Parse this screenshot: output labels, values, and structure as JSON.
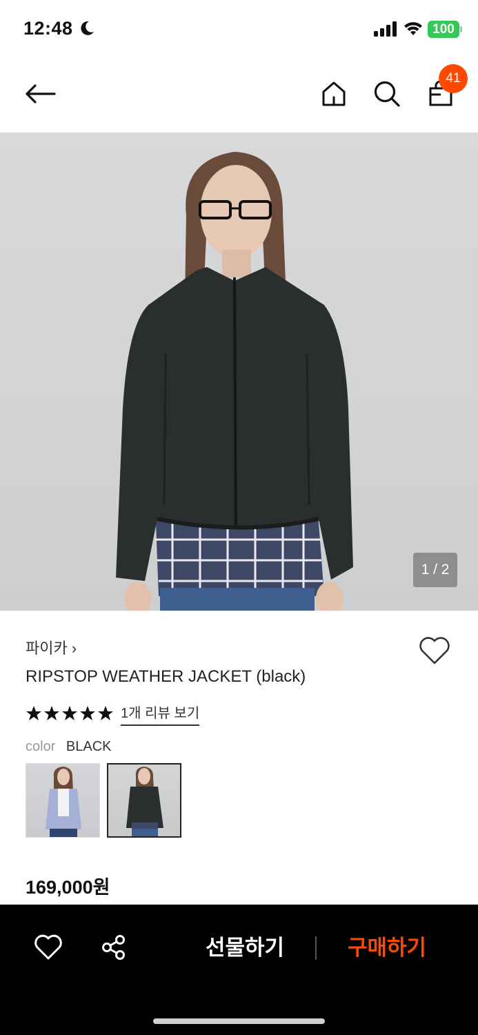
{
  "status_bar": {
    "time": "12:48",
    "battery": "100"
  },
  "nav": {
    "cart_count": "41"
  },
  "product": {
    "image_counter": "1 / 2",
    "brand": "파이카 ›",
    "name": "RIPSTOP WEATHER JACKET (black)",
    "rating_stars": 5,
    "review_link": "1개 리뷰 보기",
    "color_label": "color",
    "color_value": "BLACK",
    "price": "169,000원"
  },
  "bottom_bar": {
    "gift_label": "선물하기",
    "buy_label": "구매하기"
  },
  "colors": {
    "accent": "#ff4800",
    "battery": "#34c759",
    "bar_bg": "#000000"
  },
  "icons": [
    "moon-icon",
    "signal-icon",
    "wifi-icon",
    "back-arrow-icon",
    "home-icon",
    "search-icon",
    "shopping-bag-icon",
    "heart-icon",
    "star-icon",
    "share-icon"
  ]
}
